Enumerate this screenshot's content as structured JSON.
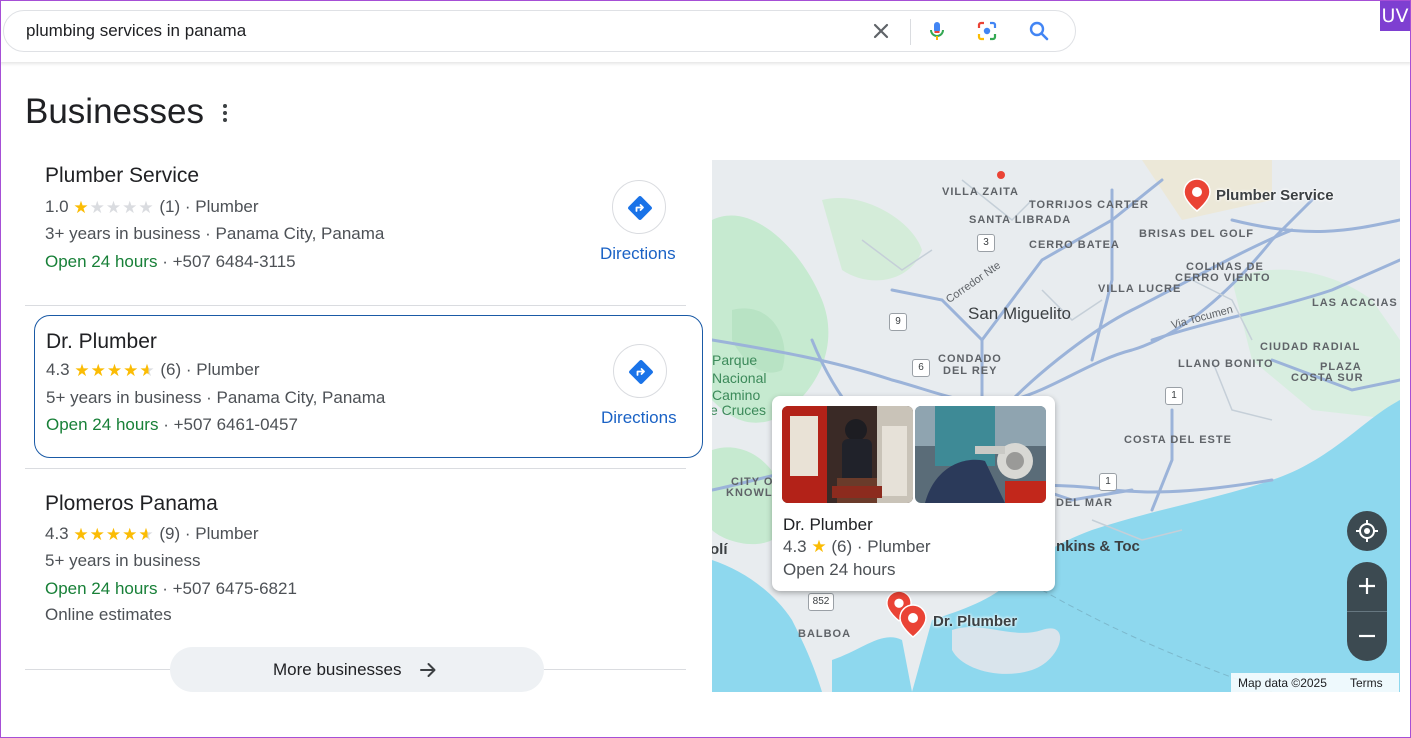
{
  "search": {
    "query": "plumbing services in panama"
  },
  "badge": "UV",
  "section": {
    "title": "Businesses"
  },
  "businesses": [
    {
      "name": "Plumber Service",
      "rating": "1.0",
      "rating_value": 1.0,
      "reviews": "(1)",
      "category": "· Plumber",
      "details": "3+ years in business · Panama City, Panama",
      "hours": "Open 24 hours",
      "phone": "· +507 6484-3115",
      "directions_label": "Directions"
    },
    {
      "name": "Dr. Plumber",
      "rating": "4.3",
      "rating_value": 4.3,
      "reviews": "(6)",
      "category": "· Plumber",
      "details": "5+ years in business · Panama City, Panama",
      "hours": "Open 24 hours",
      "phone": "· +507 6461-0457",
      "directions_label": "Directions"
    },
    {
      "name": "Plomeros Panama",
      "rating": "4.3",
      "rating_value": 4.3,
      "reviews": "(9)",
      "category": "· Plumber",
      "details": "5+ years in business",
      "hours": "Open 24 hours",
      "phone": "· +507 6475-6821",
      "extra": "Online estimates"
    }
  ],
  "more_button": {
    "label": "More businesses"
  },
  "map": {
    "labels": {
      "villa_zaita": "VILLA ZAITA",
      "torrijos_carter": "TORRIJOS CARTER",
      "santa_librada": "SANTA LIBRADA",
      "cerro_batea": "CERRO BATEA",
      "brisas_del_golf": "BRISAS DEL GOLF",
      "colinas_1": "COLINAS DE",
      "colinas_2": "CERRO VIENTO",
      "villa_lucre": "VILLA LUCRE",
      "las_acacias": "LAS ACACIAS",
      "san_miguelito": "San Miguelito",
      "corredor": "Corredor Nte",
      "via_tocumen": "Via Tocumen",
      "ciudad_radial": "CIUDAD RADIAL",
      "plaza_1": "PLAZA",
      "plaza_2": "COSTA SUR",
      "llano_bonito": "LLANO BONITO",
      "condado_1": "CONDADO",
      "condado_2": "DEL REY",
      "parque_1": "Parque",
      "parque_2": "Nacional",
      "parque_3": "Camino",
      "parque_4": "e Cruces",
      "costa_del_este": "COSTA DEL ESTE",
      "city_of_1": "CITY O",
      "city_of_2": "KNOWLE",
      "del_mar": "DEL MAR",
      "jenkins": "nkins & Toc",
      "li": "olí",
      "balboa": "BALBOA"
    },
    "routes": {
      "r3": "3",
      "r9": "9",
      "r6": "6",
      "r1a": "1",
      "r1b": "1",
      "r852": "852"
    },
    "pins": {
      "plumber_service": "Plumber Service",
      "dr_plumber": "Dr. Plumber"
    },
    "popup": {
      "name": "Dr. Plumber",
      "rating": "4.3",
      "reviews": "(6)",
      "category": "· Plumber",
      "hours": "Open 24 hours"
    },
    "attribution": {
      "data": "Map data ©2025",
      "terms": "Terms"
    },
    "colors": {
      "water": "#8ed8ee",
      "land": "#e8ecef",
      "park": "#c6ead0",
      "road": "#9bb3d9",
      "pin": "#ea4335"
    }
  },
  "colors": {
    "accent": "#1a62c5",
    "open": "#188038",
    "star": "#fbbc04",
    "selected_border": "#1a5aa6"
  }
}
